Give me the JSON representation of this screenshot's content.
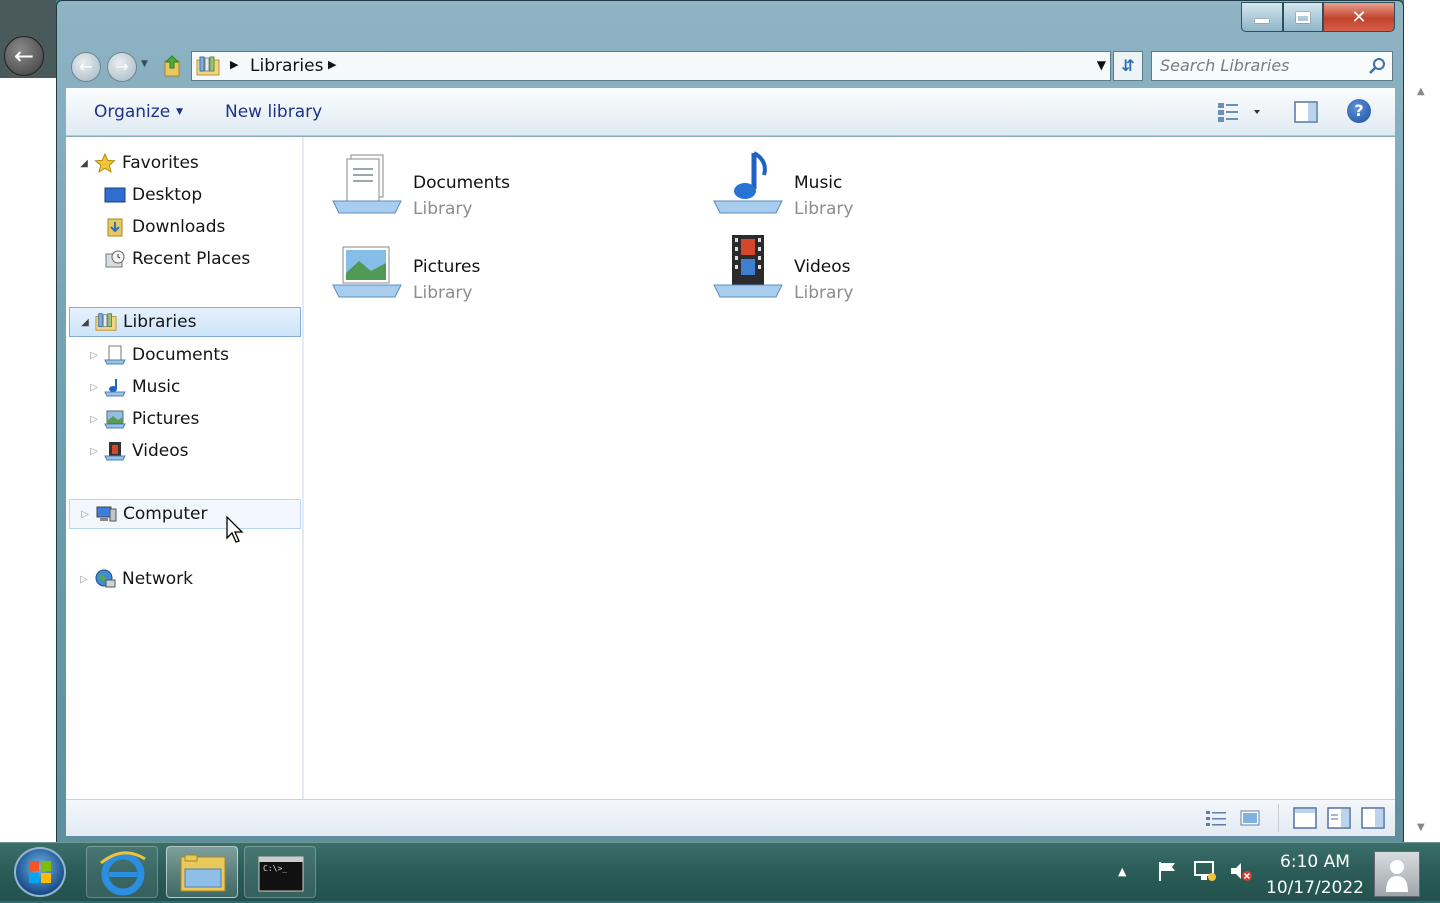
{
  "window": {
    "title_buttons": {
      "minimize": "minimize",
      "maximize": "maximize",
      "close": "✕"
    }
  },
  "address": {
    "crumb": "Libraries"
  },
  "search": {
    "placeholder": "Search Libraries"
  },
  "commandbar": {
    "organize": "Organize",
    "new_library": "New library"
  },
  "nav_pane": {
    "favorites": {
      "label": "Favorites",
      "items": [
        {
          "label": "Desktop",
          "icon": "desktop-icon"
        },
        {
          "label": "Downloads",
          "icon": "downloads-folder-icon"
        },
        {
          "label": "Recent Places",
          "icon": "recent-places-icon"
        }
      ]
    },
    "libraries": {
      "label": "Libraries",
      "selected": true,
      "items": [
        {
          "label": "Documents",
          "icon": "documents-library-icon"
        },
        {
          "label": "Music",
          "icon": "music-library-icon"
        },
        {
          "label": "Pictures",
          "icon": "pictures-library-icon"
        },
        {
          "label": "Videos",
          "icon": "videos-library-icon"
        }
      ]
    },
    "computer": {
      "label": "Computer",
      "hovered": true
    },
    "network": {
      "label": "Network"
    }
  },
  "content": {
    "libraries": [
      {
        "name": "Documents",
        "type": "Library",
        "icon": "documents-library-icon"
      },
      {
        "name": "Music",
        "type": "Library",
        "icon": "music-library-icon"
      },
      {
        "name": "Pictures",
        "type": "Library",
        "icon": "pictures-library-icon"
      },
      {
        "name": "Videos",
        "type": "Library",
        "icon": "videos-library-icon"
      }
    ]
  },
  "taskbar": {
    "pinned": [
      {
        "name": "Internet Explorer",
        "icon": "internet-explorer-icon"
      },
      {
        "name": "Windows Explorer",
        "icon": "windows-explorer-icon",
        "active": true
      },
      {
        "name": "Command Prompt",
        "icon": "command-prompt-icon"
      }
    ],
    "clock": {
      "time": "6:10 AM",
      "date": "10/17/2022"
    }
  },
  "colors": {
    "link_blue": "#1e3287",
    "selection": "#cde4fa",
    "close_red": "#c2422b"
  }
}
